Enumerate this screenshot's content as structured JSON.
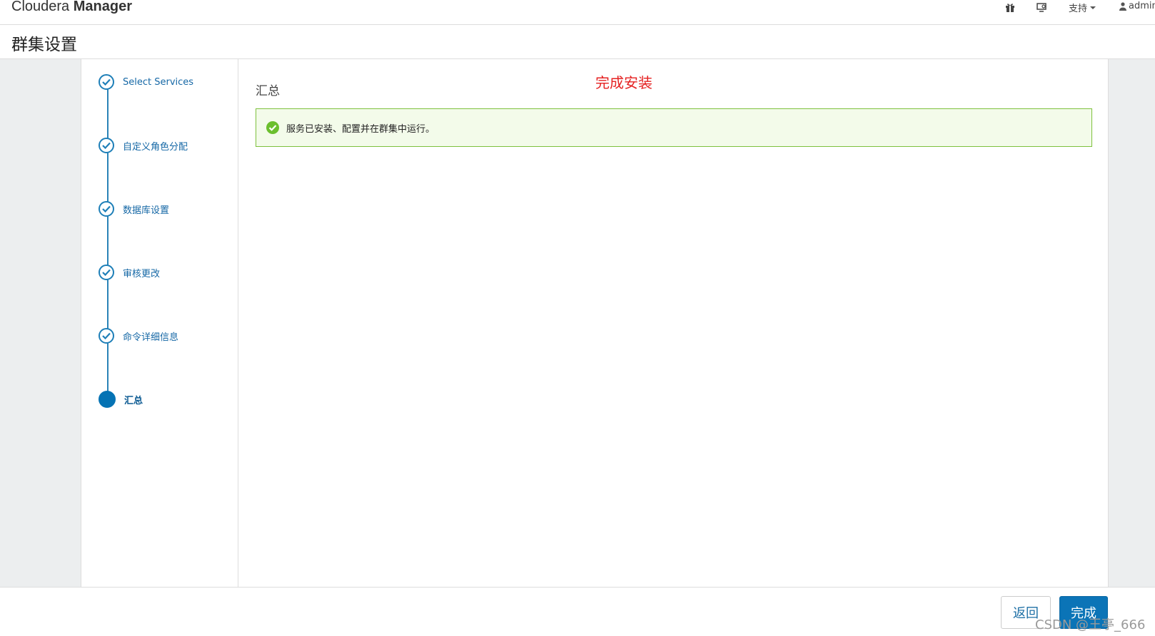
{
  "app": {
    "brand_part1": "Cloudera",
    "brand_part2": "Manager"
  },
  "topbar": {
    "icons": [
      "gift-icon",
      "monitor-icon"
    ],
    "support_label": "支持",
    "user_label": "admin"
  },
  "page": {
    "title": "群集设置"
  },
  "wizard": {
    "steps": [
      {
        "label": "Select Services",
        "state": "done"
      },
      {
        "label": "自定义角色分配",
        "state": "done"
      },
      {
        "label": "数据库设置",
        "state": "done"
      },
      {
        "label": "审核更改",
        "state": "done"
      },
      {
        "label": "命令详细信息",
        "state": "done"
      },
      {
        "label": "汇总",
        "state": "current"
      }
    ]
  },
  "content": {
    "annotation": "完成安装",
    "section_title": "汇总",
    "alert_text": "服务已安装、配置并在群集中运行。"
  },
  "footer": {
    "back_label": "返回",
    "finish_label": "完成",
    "watermark": "CSDN @王亭_666"
  },
  "colors": {
    "accent": "#0b74b7",
    "success_border": "#7ec13d",
    "success_bg": "#f3fbea",
    "annotation": "#e52222"
  }
}
